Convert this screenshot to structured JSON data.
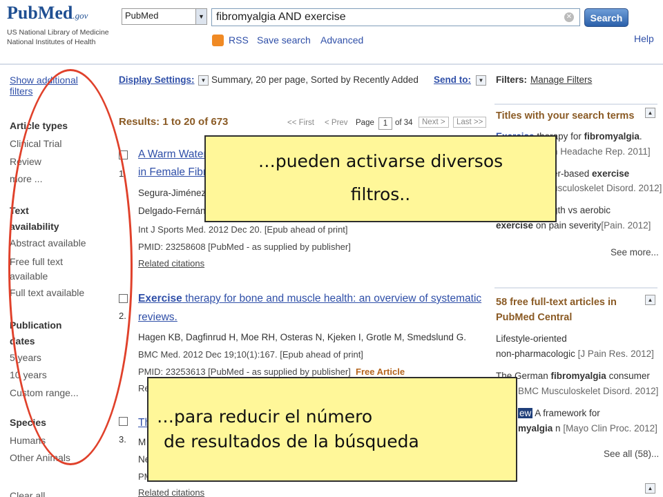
{
  "header": {
    "logo_text": "PubMed",
    "logo_suffix": ".gov",
    "org_line1": "US National Library of Medicine",
    "org_line2": "National Institutes of Health",
    "database_select": "PubMed",
    "search_value": "fibromyalgia AND exercise",
    "search_button": "Search",
    "links": [
      "RSS",
      "Save search",
      "Advanced"
    ],
    "help": "Help"
  },
  "sidebar": {
    "show_additional": "Show additional filters",
    "groups": [
      {
        "heading": "Article types",
        "items": [
          "Clinical Trial",
          "Review",
          "more ..."
        ]
      },
      {
        "heading": "Text availability",
        "items": [
          "Abstract available",
          "Free full text available",
          "Full text available"
        ]
      },
      {
        "heading": "Publication dates",
        "items": [
          "5 years",
          "10 years",
          "Custom range..."
        ]
      },
      {
        "heading": "Species",
        "items": [
          "Humans",
          "Other Animals"
        ]
      }
    ],
    "clear_all": "Clear all"
  },
  "display": {
    "settings_label": "Display Settings:",
    "settings_value": "Summary, 20 per page, Sorted by Recently Added",
    "send_to": "Send to:"
  },
  "results": {
    "header": "Results: 1 to 20 of 673",
    "pager": {
      "first": "<< First",
      "prev": "< Prev",
      "page_label": "Page",
      "page_value": "1",
      "of": "of 34",
      "next": "Next >",
      "last": "Last >>"
    },
    "items": [
      {
        "num": "1.",
        "title_line1": "A Warm Water",
        "title_line2": "in Female Fibr",
        "authors1": "Segura-Jiménez",
        "authors2": "Delgado-Fernán",
        "source": "Int J Sports Med. 2012 Dec 20. [Epub ahead of print]",
        "pmid": "PMID: 23258608 [PubMed - as supplied by publisher]",
        "related": "Related citations"
      },
      {
        "num": "2.",
        "title_bold": "Exercise",
        "title_line1": " therapy for bone and muscle health: an overview of systematic",
        "title_line2": "reviews.",
        "authors": "Hagen KB, Dagfinrud H, Moe RH, Osteras N, Kjeken I, Grotle M, Smedslund G.",
        "source": "BMC Med. 2012 Dec 19;10(1):167. [Epub ahead of print]",
        "pmid": "PMID: 23253613 [PubMed - as supplied by publisher]",
        "free": "Free Article",
        "related_frag": "Re"
      },
      {
        "num": "3.",
        "title_frag": "Th",
        "authors_frag1": "M",
        "authors_frag2": "Ne",
        "source_frag": "PM",
        "related": "Related citations"
      }
    ]
  },
  "filters": {
    "label": "Filters:",
    "manage": "Manage Filters"
  },
  "right_panels": {
    "titles_panel": {
      "title": "Titles with your search terms",
      "items": [
        {
          "line1_bold": "Exercise",
          "line1": " therapy for ",
          "line1_bold2": "fibromyalgia",
          "line1_end": ".",
          "line2": "n Headache Rep. 2011]"
        },
        {
          "line1": "er-based ",
          "line1_bold": "exercise",
          "line2": "usculoskelet Disord. 2012]"
        },
        {
          "line1": "gth vs aerobic",
          "line2_bold": "exercise",
          "line2": " on pain severity",
          "journal": "[Pain. 2012]"
        }
      ],
      "see_more": "See more..."
    },
    "pmc_panel": {
      "title_line1": "58 free full-text articles in",
      "title_line2": "PubMed Central",
      "items": [
        {
          "line1": "Lifestyle-oriented",
          "line2": "non-pharmacologic",
          "journal": "[J Pain Res. 2012]"
        },
        {
          "line1_pre": "The German ",
          "line1_bold": "fibromyalgia",
          "line1": " consumer",
          "line2": "BMC Musculoskelet Disord. 2012]"
        },
        {
          "line1_tag": "ew",
          "line1": " A framework for",
          "line2_bold": "myalgia",
          "line2": " n",
          "journal": "[Mayo Clin Proc. 2012]"
        }
      ],
      "see_all": "See all (58)..."
    }
  },
  "callouts": {
    "top_line1": "…pueden activarse diversos",
    "top_line2": "filtros..",
    "bottom_line1": "…para reducir el número",
    "bottom_line2": "de resultados de la búsqueda"
  },
  "colors": {
    "link": "#2f4fa8",
    "callout_bg": "#fff799",
    "oval": "#e0412b",
    "heading_brown": "#8a5a24"
  }
}
